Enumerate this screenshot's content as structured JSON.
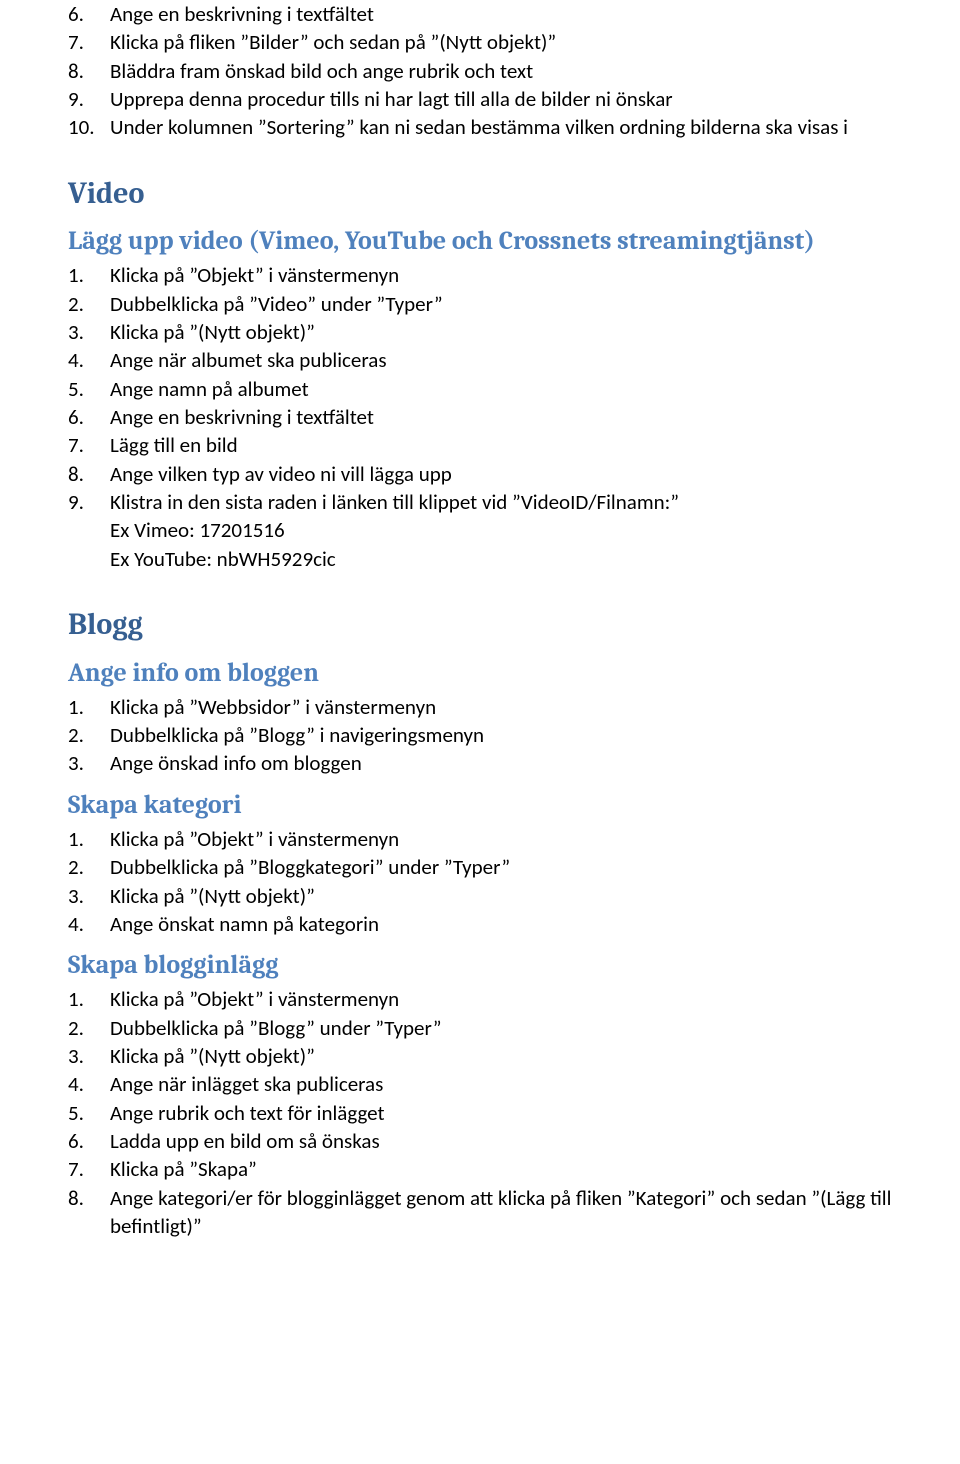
{
  "topList": {
    "start": 6,
    "items": [
      "Ange en beskrivning i textfältet",
      "Klicka på fliken ”Bilder” och sedan på ”(Nytt objekt)”",
      "Bläddra fram önskad bild och ange rubrik och text",
      "Upprepa denna procedur tills ni har lagt till alla de bilder ni önskar",
      "Under kolumnen ”Sortering” kan ni sedan bestämma vilken ordning bilderna ska visas i"
    ]
  },
  "video": {
    "heading": "Video",
    "sub1": {
      "heading": "Lägg upp video (Vimeo, YouTube och Crossnets streamingtjänst)",
      "items": [
        "Klicka på ”Objekt” i vänstermenyn",
        "Dubbelklicka på ”Video” under ”Typer”",
        "Klicka på ”(Nytt objekt)”",
        "Ange när albumet ska publiceras",
        "Ange namn på albumet",
        "Ange en beskrivning i textfältet",
        "Lägg till en bild",
        "Ange vilken typ av video ni vill lägga upp",
        "Klistra in den sista raden i länken till klippet vid ”VideoID/Filnamn:”"
      ],
      "extra": [
        "Ex Vimeo: 17201516",
        "Ex YouTube: nbWH5929cic"
      ]
    }
  },
  "blogg": {
    "heading": "Blogg",
    "sub1": {
      "heading": "Ange info om bloggen",
      "items": [
        "Klicka på ”Webbsidor” i vänstermenyn",
        "Dubbelklicka på ”Blogg” i navigeringsmenyn",
        "Ange önskad info om bloggen"
      ]
    },
    "sub2": {
      "heading": "Skapa kategori",
      "items": [
        "Klicka på ”Objekt” i vänstermenyn",
        "Dubbelklicka på ”Bloggkategori” under ”Typer”",
        "Klicka på ”(Nytt objekt)”",
        "Ange önskat namn på kategorin"
      ]
    },
    "sub3": {
      "heading": "Skapa blogginlägg",
      "items": [
        "Klicka på ”Objekt” i vänstermenyn",
        "Dubbelklicka på ”Blogg” under ”Typer”",
        "Klicka på ”(Nytt objekt)”",
        "Ange när inlägget ska publiceras",
        "Ange rubrik och text för inlägget",
        "Ladda upp en bild om så önskas",
        "Klicka på ”Skapa”",
        "Ange kategori/er för blogginlägget genom att klicka på fliken ”Kategori” och sedan ”(Lägg till befintligt)”"
      ]
    }
  }
}
